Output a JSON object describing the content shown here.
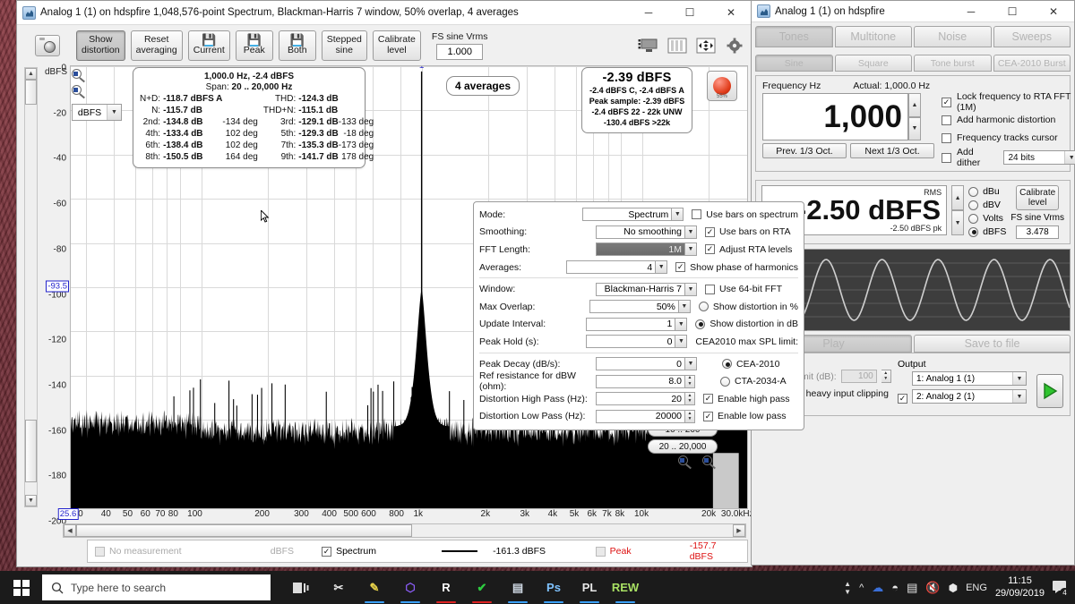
{
  "spectrum_window": {
    "title": "Analog 1 (1) on hdspfire 1,048,576-point Spectrum, Blackman-Harris 7 window, 50% overlap, 4 averages",
    "window_buttons": {
      "minimize": "─",
      "maximize": "☐",
      "close": "✕"
    },
    "toolbar": {
      "camera_icon": "camera-icon",
      "unit_label": "dBFS",
      "buttons": [
        {
          "name": "show-distortion",
          "line1": "Show",
          "line2": "distortion",
          "pressed": true
        },
        {
          "name": "reset-averaging",
          "line1": "Reset",
          "line2": "averaging",
          "pressed": false
        },
        {
          "name": "save-current",
          "glyph": "💾",
          "line2": "Current",
          "pressed": false
        },
        {
          "name": "save-peak",
          "glyph": "💾",
          "line2": "Peak",
          "pressed": false
        },
        {
          "name": "save-both",
          "glyph": "💾",
          "line2": "Both",
          "pressed": false
        },
        {
          "name": "stepped-sine",
          "line1": "Stepped",
          "line2": "sine",
          "pressed": false
        },
        {
          "name": "calibrate-level",
          "line1": "Calibrate",
          "line2": "level",
          "pressed": false
        }
      ],
      "fs_sine_label": "FS sine Vrms",
      "fs_sine_value": "1.000",
      "right_icons": [
        "display-icon",
        "bars-icon",
        "move-icon",
        "gear-icon"
      ]
    },
    "axis_unit_select": "dBFS",
    "info_box": {
      "frequency_line": "1,000.0 Hz, -2.4 dBFS",
      "span_label": "Span: ",
      "span_value": "20 .. 20,000 Hz",
      "rows": [
        {
          "k1": "N+D:",
          "v1": "-118.7 dBFS A",
          "d1": "",
          "k2": "THD:",
          "v2": "-124.3 dB",
          "d2": ""
        },
        {
          "k1": "N:",
          "v1": "-115.7 dB",
          "d1": "",
          "k2": "THD+N:",
          "v2": "-115.1 dB",
          "d2": ""
        },
        {
          "k1": "2nd:",
          "v1": "-134.8 dB",
          "d1": "-134 deg",
          "k2": "3rd:",
          "v2": "-129.1 dB",
          "d2": "-133 deg"
        },
        {
          "k1": "4th:",
          "v1": "-133.4 dB",
          "d1": "102 deg",
          "k2": "5th:",
          "v2": "-129.3 dB",
          "d2": "-18 deg"
        },
        {
          "k1": "6th:",
          "v1": "-138.4 dB",
          "d1": "102 deg",
          "k2": "7th:",
          "v2": "-135.3 dB",
          "d2": "-173 deg"
        },
        {
          "k1": "8th:",
          "v1": "-150.5 dB",
          "d1": "164 deg",
          "k2": "9th:",
          "v2": "-141.7 dB",
          "d2": "178 deg"
        }
      ]
    },
    "averages_badge": "4 averages",
    "level_box": {
      "main": "-2.39 dBFS",
      "line1": "-2.4 dBFS C, -2.4 dBFS A",
      "line2": "Peak sample: -2.39 dBFS",
      "line3": "-2.4 dBFS 22 - 22k UNW",
      "line4": "-130.4 dBFS >22k",
      "led_percent": "55%"
    },
    "settings": {
      "rows": [
        {
          "label": "Mode:",
          "value": "Spectrum",
          "control": "dropdown",
          "selected": false
        },
        {
          "label": "Smoothing:",
          "value": "No  smoothing",
          "control": "dropdown",
          "selected": false
        },
        {
          "label": "FFT Length:",
          "value": "1M",
          "control": "dropdown",
          "selected": true
        },
        {
          "label": "Averages:",
          "value": "4",
          "control": "dropdown",
          "selected": false
        },
        {
          "label": "Window:",
          "value": "Blackman-Harris 7",
          "control": "dropdown",
          "selected": false
        },
        {
          "label": "Max Overlap:",
          "value": "50%",
          "control": "dropdown",
          "selected": false
        },
        {
          "label": "Update Interval:",
          "value": "1",
          "control": "dropdown",
          "selected": false
        },
        {
          "label": "Peak Hold (s):",
          "value": "0",
          "control": "dropdown",
          "selected": false
        },
        {
          "label": "Peak Decay (dB/s):",
          "value": "0",
          "control": "dropdown",
          "selected": false
        },
        {
          "label": "Ref resistance for dBW (ohm):",
          "value": "8.0",
          "control": "spinner",
          "selected": false
        },
        {
          "label": "Distortion High Pass (Hz):",
          "value": "20",
          "control": "spinner",
          "selected": false
        },
        {
          "label": "Distortion Low Pass (Hz):",
          "value": "20000",
          "control": "spinner",
          "selected": false
        }
      ],
      "right_controls": [
        {
          "type": "checkbox",
          "label": "Use bars on spectrum",
          "checked": false
        },
        {
          "type": "checkbox",
          "label": "Use bars on RTA",
          "checked": true
        },
        {
          "type": "checkbox",
          "label": "Adjust RTA levels",
          "checked": true
        },
        {
          "type": "checkbox",
          "label": "Show phase of harmonics",
          "checked": true
        },
        {
          "type": "checkbox",
          "label": "Use 64-bit FFT",
          "checked": false
        },
        {
          "type": "radio",
          "label": "Show distortion in %",
          "checked": false
        },
        {
          "type": "radio",
          "label": "Show distortion in dB",
          "checked": true
        },
        {
          "type": "text",
          "label": "CEA2010 max SPL limit:",
          "checked": false
        },
        {
          "type": "radio",
          "label": "CEA-2010",
          "checked": true,
          "indent": true
        },
        {
          "type": "radio",
          "label": "CTA-2034-A",
          "checked": false,
          "indent": true
        },
        {
          "type": "checkbox",
          "label": "Enable high pass",
          "checked": true
        },
        {
          "type": "checkbox",
          "label": "Enable low pass",
          "checked": true
        }
      ]
    },
    "range_buttons": [
      "10 .. 200",
      "20 .. 20,000"
    ],
    "status_bar": {
      "measurement": "No measurement",
      "unit": "dBFS",
      "spectrum_label": "Spectrum",
      "spectrum_value": "-161.3 dBFS",
      "peak_label": "Peak",
      "peak_value": "-157.7 dBFS",
      "peak_color": "#dd1111"
    }
  },
  "chart_data": {
    "type": "line",
    "title": "1,048,576-point Spectrum",
    "xlabel": "Hz",
    "ylabel": "dBFS",
    "xlim": [
      25.6,
      30000
    ],
    "ylim": [
      -200,
      0
    ],
    "xscale": "log",
    "grid": true,
    "y_ticks": [
      0,
      -20,
      -40,
      -60,
      -80,
      -100,
      -120,
      -140,
      -160,
      -180,
      -200
    ],
    "x_ticks": [
      "30",
      "40",
      "50",
      "60",
      "70",
      "80",
      "100",
      "200",
      "300",
      "400",
      "500",
      "600",
      "800",
      "1k",
      "2k",
      "3k",
      "4k",
      "5k",
      "6k",
      "7k",
      "8k",
      "10k",
      "20k",
      "30.0kHz"
    ],
    "x_cursor_label": "25.6",
    "y_cursor_label": "-93.5",
    "x_axis_unit": "30.0kHz",
    "fundamental": {
      "freq_hz": 1000,
      "level_dbfs": -2.4,
      "label": "1"
    },
    "harmonics": [
      {
        "order": 2,
        "freq_hz": 2000,
        "level_db": -134.8,
        "phase_deg": -134
      },
      {
        "order": 3,
        "freq_hz": 3000,
        "level_db": -129.1,
        "phase_deg": -133
      },
      {
        "order": 4,
        "freq_hz": 4000,
        "level_db": -133.4,
        "phase_deg": 102
      },
      {
        "order": 5,
        "freq_hz": 5000,
        "level_db": -129.3,
        "phase_deg": -18
      },
      {
        "order": 6,
        "freq_hz": 6000,
        "level_db": -138.4,
        "phase_deg": 102
      },
      {
        "order": 7,
        "freq_hz": 7000,
        "level_db": -135.3,
        "phase_deg": -173
      },
      {
        "order": 8,
        "freq_hz": 8000,
        "level_db": -150.5,
        "phase_deg": 164
      },
      {
        "order": 9,
        "freq_hz": 9000,
        "level_db": -141.7,
        "phase_deg": 178
      }
    ],
    "noise_floor_dbfs": -161.3,
    "series_color": "#000000",
    "harmonic_label_color": "#3333cc"
  },
  "generator_window": {
    "title": "Analog 1 (1) on hdspfire",
    "window_buttons": {
      "minimize": "─",
      "maximize": "☐",
      "close": "✕"
    },
    "tabs": [
      {
        "label": "Tones",
        "active": true
      },
      {
        "label": "Multitone",
        "active": false
      },
      {
        "label": "Noise",
        "active": false
      },
      {
        "label": "Sweeps",
        "active": false
      }
    ],
    "subtabs": [
      {
        "label": "Sine",
        "active": true
      },
      {
        "label": "Square",
        "active": false
      },
      {
        "label": "Tone burst",
        "active": false
      },
      {
        "label": "CEA-2010 Burst",
        "active": false
      }
    ],
    "frequency": {
      "label": "Frequency Hz",
      "actual": "Actual: 1,000.0 Hz",
      "value": "1,000",
      "prev_button": "Prev. 1/3 Oct.",
      "next_button": "Next 1/3 Oct.",
      "options": [
        {
          "label": "Lock frequency to RTA FFT (1M)",
          "checked": true
        },
        {
          "label": "Add harmonic distortion",
          "checked": false
        },
        {
          "label": "Frequency tracks cursor",
          "checked": false
        },
        {
          "label": "Add dither",
          "checked": false
        }
      ],
      "dither_bits": "24 bits"
    },
    "level": {
      "rms_label": "RMS",
      "value": "-2.50 dBFS",
      "peak_label": "-2.50 dBFS pk",
      "units": [
        {
          "label": "dBu",
          "checked": false
        },
        {
          "label": "dBV",
          "checked": false
        },
        {
          "label": "Volts",
          "checked": false
        },
        {
          "label": "dBFS",
          "checked": true
        }
      ],
      "calibrate_button_line1": "Calibrate",
      "calibrate_button_line2": "level",
      "fs_sine_label": "FS sine Vrms",
      "fs_sine_value": "3.478"
    },
    "play_tabs": [
      {
        "label": "Play",
        "active": true
      },
      {
        "label": "Save to file",
        "active": false
      }
    ],
    "output": {
      "spl_limit_label": "SPL limit (dB):",
      "spl_limit_checked": false,
      "spl_limit_value": "100",
      "stop_clipping_label": "Stop if heavy input clipping occurs",
      "stop_clipping_checked": true,
      "output_label": "Output",
      "channels": [
        {
          "label": "1: Analog 1 (1)",
          "checked": null
        },
        {
          "label": "2: Analog 2 (1)",
          "checked": true
        }
      ],
      "play_icon": "play-icon",
      "play_icon_color": "#22bb22"
    }
  },
  "taskbar": {
    "start_icon": "windows-icon",
    "search_placeholder": "Type here to search",
    "search_icon": "search-icon",
    "task_view_icon": "task-view-icon",
    "pinned": [
      {
        "name": "snip-tool-icon",
        "glyph": "✂",
        "color": "#e8e8e8",
        "underline": ""
      },
      {
        "name": "editor-icon",
        "glyph": "✎",
        "color": "#e7d24a",
        "underline": "#3aa0ff"
      },
      {
        "name": "visual-studio-code-icon",
        "glyph": "⬡",
        "color": "#8a5cf6",
        "underline": "#3aa0ff"
      },
      {
        "name": "r-studio-icon",
        "glyph": "R",
        "color": "#ffffff",
        "underline": "#dd2222"
      },
      {
        "name": "checkmark-app-icon",
        "glyph": "✔",
        "color": "#2ecc40",
        "underline": "#dd2222"
      },
      {
        "name": "scanner-icon",
        "glyph": "▤",
        "color": "#cfd8e3",
        "underline": "#3aa0ff"
      },
      {
        "name": "photoshop-icon",
        "glyph": "Ps",
        "color": "#7fc3ff",
        "underline": "#3aa0ff"
      },
      {
        "name": "pl-icon",
        "glyph": "PL",
        "color": "#e8e8e8",
        "underline": "#3aa0ff"
      },
      {
        "name": "rew-icon",
        "glyph": "REW",
        "color": "#a8e063",
        "underline": "#3aa0ff"
      }
    ],
    "tray": {
      "chevron_icon": "chevron-up-icon",
      "cloud_icon": "onedrive-error-icon",
      "wifi_icon": "wifi-icon",
      "battery_icon": "battery-icon",
      "volume_icon": "volume-muted-icon",
      "bluetooth_icon": "bluetooth-icon",
      "language": "ENG",
      "time": "11:15",
      "date": "29/09/2019",
      "notification_icon": "notifications-icon",
      "notification_count": "4"
    }
  }
}
